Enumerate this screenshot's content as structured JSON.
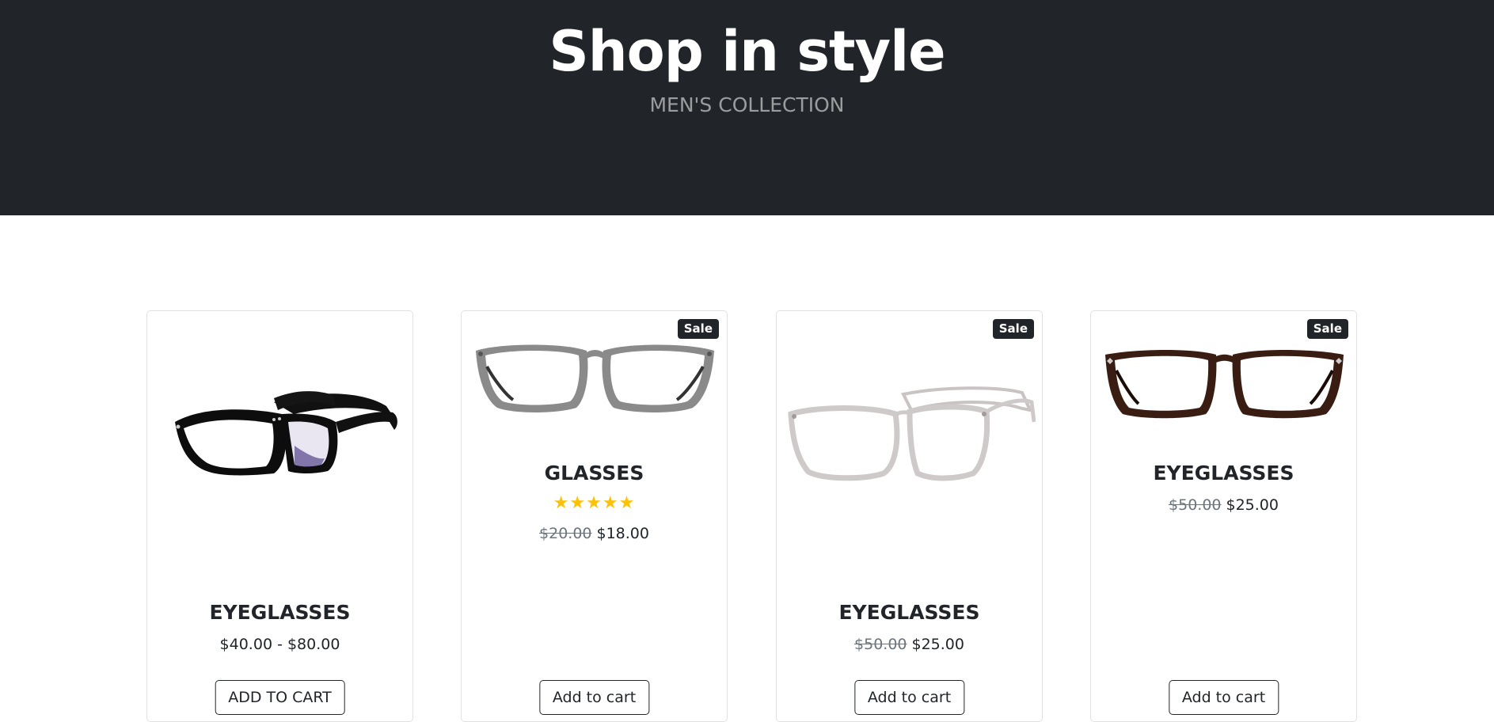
{
  "header": {
    "title": "Shop in style",
    "subtitle": "MEN'S COLLECTION"
  },
  "products": [
    {
      "name": "EYEGLASSES",
      "price_range": "$40.00 - $80.00",
      "button_label": "ADD TO CART",
      "image": "black-wayfarer-glasses"
    },
    {
      "badge": "Sale",
      "name": "GLASSES",
      "rating": "★★★★★",
      "old_price": "$20.00",
      "price": "$18.00",
      "button_label": "Add to cart",
      "image": "grey-square-glasses"
    },
    {
      "badge": "Sale",
      "name": "EYEGLASSES",
      "old_price": "$50.00",
      "price": "$25.00",
      "button_label": "Add to cart",
      "image": "clear-frame-glasses"
    },
    {
      "badge": "Sale",
      "name": "EYEGLASSES",
      "old_price": "$50.00",
      "price": "$25.00",
      "button_label": "Add to cart",
      "image": "tortoise-rectangular-glasses"
    }
  ],
  "colors": {
    "header_bg": "#212529",
    "star": "#ffc107",
    "muted": "#6c757d"
  }
}
